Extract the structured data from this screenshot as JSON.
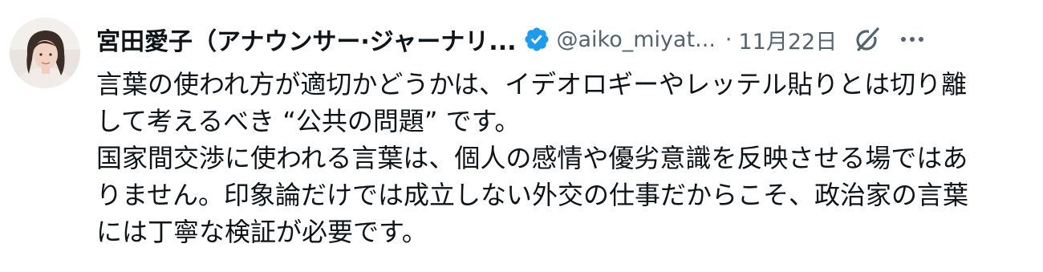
{
  "tweet": {
    "author": {
      "display_name": "宮田愛子（アナウンサー·ジャーナリ...",
      "handle": "@aiko_miyat...",
      "verified": true
    },
    "separator": "·",
    "date": "11月22日",
    "body_lines": [
      "言葉の使われ方が適切かどうかは、イデオロギーやレッテル貼りとは切り離",
      "して考えるべき “公共の問題” です。",
      "国家間交渉に使われる言葉は、個人の感情や優劣意識を反映させる場ではあ",
      "りません。印象論だけでは成立しない外交の仕事だからこそ、政治家の言葉",
      "には丁寧な検証が必要です。"
    ]
  },
  "icons": {
    "verified": "verified-badge-icon",
    "grok": "grok-icon",
    "more": "more-options-icon"
  },
  "colors": {
    "verified_blue": "#1d9bf0",
    "secondary_text": "#536471",
    "primary_text": "#0f1419"
  }
}
